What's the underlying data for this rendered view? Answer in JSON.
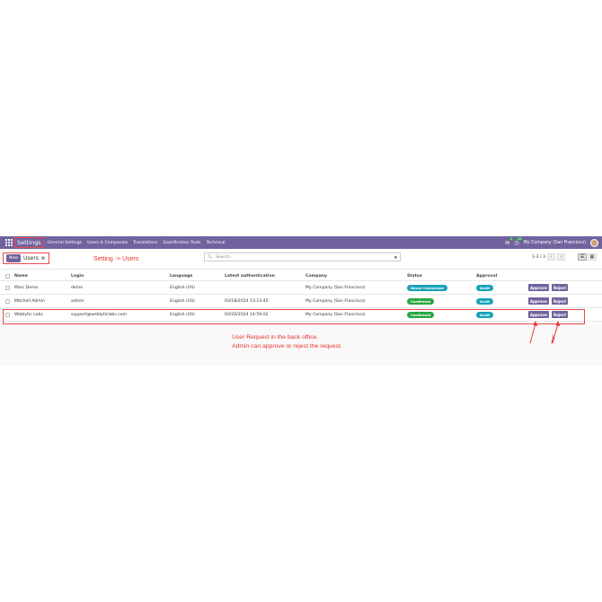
{
  "navbar": {
    "brand": "Settings",
    "menu": [
      "General Settings",
      "Users & Companies",
      "Translations",
      "Gamification Tools",
      "Technical"
    ],
    "chat_badge": "2",
    "activity_badge": "25",
    "company": "My Company (San Francisco)"
  },
  "control": {
    "new_label": "New",
    "title": "Users",
    "annotation": "Setting -> Users",
    "search_placeholder": "Search...",
    "pager": "1-3 / 3"
  },
  "table": {
    "headers": {
      "name": "Name",
      "login": "Login",
      "language": "Language",
      "latest": "Latest authentication",
      "company": "Company",
      "status": "Status",
      "approval": "Approval"
    },
    "rows": [
      {
        "name": "Marc Demo",
        "login": "demo",
        "language": "English (US)",
        "latest": "",
        "company": "My Company (San Francisco)",
        "status": "Never Connected",
        "approval": "Draft"
      },
      {
        "name": "Mitchell Admin",
        "login": "admin",
        "language": "English (US)",
        "latest": "03/18/2024 13:13:45",
        "company": "My Company (San Francisco)",
        "status": "Confirmed",
        "approval": "Draft"
      },
      {
        "name": "Weblytic Labs",
        "login": "support@weblyticlabs.com",
        "language": "English (US)",
        "latest": "03/20/2024 14:59:02",
        "company": "My Company (San Francisco)",
        "status": "Confirmed",
        "approval": "Draft"
      }
    ],
    "approve_label": "Approve",
    "reject_label": "Reject"
  },
  "annotations": {
    "line1": "User Request in the back office.",
    "line2": "Admin can approve or reject the request."
  },
  "colors": {
    "brand": "#71639e",
    "annotation": "#e8352e",
    "never_connected": "#17a2b8",
    "confirmed": "#28a745"
  }
}
